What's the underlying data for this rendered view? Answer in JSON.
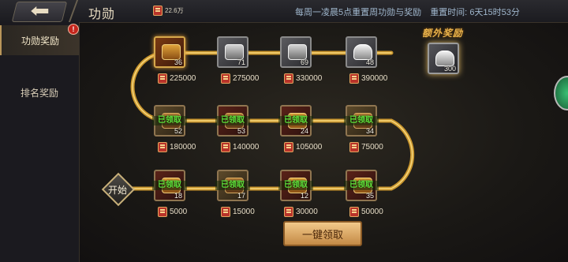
{
  "header": {
    "title": "功勋",
    "currency_value": "22.6万",
    "notice": "每周一凌晨5点重置周功勋与奖励",
    "reset_label": "重置时间:",
    "reset_time": "6天15时53分"
  },
  "sidebar": {
    "tabs": [
      {
        "label": "功勋奖励",
        "active": true,
        "alert": "!"
      },
      {
        "label": "排名奖励",
        "active": false
      }
    ]
  },
  "track": {
    "start_label": "开始",
    "claimed_label": "已领取",
    "nodes": [
      {
        "count": "18",
        "amount": "5000",
        "claimed": true,
        "style": "red",
        "art": "chest"
      },
      {
        "count": "17",
        "amount": "15000",
        "claimed": true,
        "style": "brown",
        "art": "box"
      },
      {
        "count": "12",
        "amount": "30000",
        "claimed": true,
        "style": "red",
        "art": "chest"
      },
      {
        "count": "35",
        "amount": "50000",
        "claimed": true,
        "style": "red",
        "art": "chest"
      },
      {
        "count": "34",
        "amount": "75000",
        "claimed": true,
        "style": "brown",
        "art": "box"
      },
      {
        "count": "24",
        "amount": "105000",
        "claimed": true,
        "style": "red",
        "art": "chest"
      },
      {
        "count": "53",
        "amount": "140000",
        "claimed": true,
        "style": "red",
        "art": "box"
      },
      {
        "count": "52",
        "amount": "180000",
        "claimed": true,
        "style": "brown",
        "art": "box"
      },
      {
        "count": "36",
        "amount": "225000",
        "claimed": false,
        "style": "gold",
        "art": "chest"
      },
      {
        "count": "71",
        "amount": "275000",
        "claimed": false,
        "style": "silver",
        "art": "metal"
      },
      {
        "count": "69",
        "amount": "330000",
        "claimed": false,
        "style": "silver",
        "art": "metal"
      },
      {
        "count": "48",
        "amount": "390000",
        "claimed": false,
        "style": "silver",
        "art": "ingot"
      }
    ]
  },
  "extra_reward": {
    "title": "额外奖励",
    "count": "300"
  },
  "claim_all_label": "一键领取"
}
